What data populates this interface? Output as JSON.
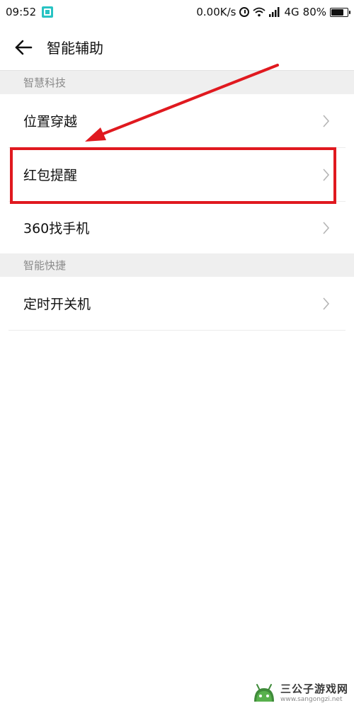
{
  "status_bar": {
    "time": "09:52",
    "net_speed": "0.00K/s",
    "network": "4G",
    "battery_text": "80%",
    "battery_level": 0.8
  },
  "header": {
    "title": "智能辅助"
  },
  "sections": [
    {
      "title": "智慧科技",
      "items": [
        {
          "label": "位置穿越"
        },
        {
          "label": "红包提醒"
        },
        {
          "label": "360找手机"
        }
      ]
    },
    {
      "title": "智能快捷",
      "items": [
        {
          "label": "定时开关机"
        }
      ]
    }
  ],
  "watermark": {
    "name": "三公子游戏网",
    "url": "www.sangongzi.net"
  },
  "colors": {
    "highlight": "#e0191f",
    "section_bg": "#efefef",
    "notification_icon": "#28c3c3"
  },
  "icons": {
    "back": "arrow-left-icon",
    "chevron": "chevron-right-icon"
  }
}
